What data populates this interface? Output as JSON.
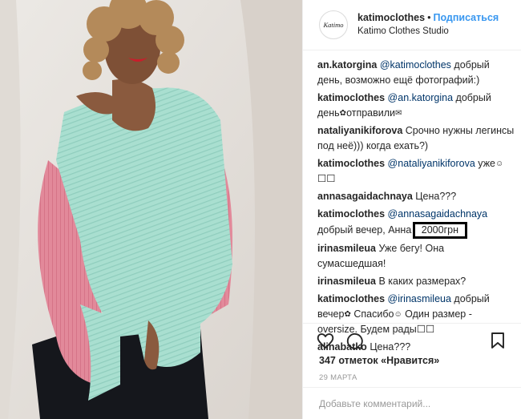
{
  "header": {
    "avatar_text": "Katimo",
    "username": "katimoclothes",
    "separator": "•",
    "follow_label": "Подписаться",
    "location": "Katimo Clothes Studio"
  },
  "comments": [
    {
      "user": "an.katorgina",
      "mention": "@katimoclothes",
      "text": " добрый день, возможно ещё фотографий:)"
    },
    {
      "user": "katimoclothes",
      "mention": "@an.katorgina",
      "text": " добрый день",
      "emoji1": "✿",
      "text2": "отправили",
      "emoji2": "✉"
    },
    {
      "user": "nataliyanikiforova",
      "mention": "",
      "text": "Срочно нужны легинсы под неё))) когда ехать?)"
    },
    {
      "user": "katimoclothes",
      "mention": "@nataliyanikiforova",
      "text": " уже",
      "emoji1": "☺",
      "text2": " ☐☐"
    },
    {
      "user": "annasagaidachnaya",
      "mention": "",
      "text": "Цена???"
    },
    {
      "user": "katimoclothes",
      "mention": "@annasagaidachnaya",
      "text": " добрый вечер, Анна ",
      "highlight": "2000грн"
    },
    {
      "user": "irinasmileua",
      "mention": "",
      "text": "Уже бегу! Она сумасшедшая!"
    },
    {
      "user": "irinasmileua",
      "mention": "",
      "text": "В каких размерах?"
    },
    {
      "user": "katimoclothes",
      "mention": "@irinasmileua",
      "text": " добрый вечер",
      "emoji1": "✿",
      "text2": " Спасибо",
      "emoji2": "☺",
      "text3": " Один размер - oversize. Будем рады☐☐"
    },
    {
      "user": "alinabatko",
      "mention": "",
      "text": "Цена???"
    }
  ],
  "icons": {
    "like": "heart-icon",
    "comment": "comment-bubble-icon",
    "save": "bookmark-icon"
  },
  "likes": "347 отметок «Нравится»",
  "date": "29 МАРТА",
  "comment_input": {
    "placeholder": "Добавьте комментарий..."
  }
}
